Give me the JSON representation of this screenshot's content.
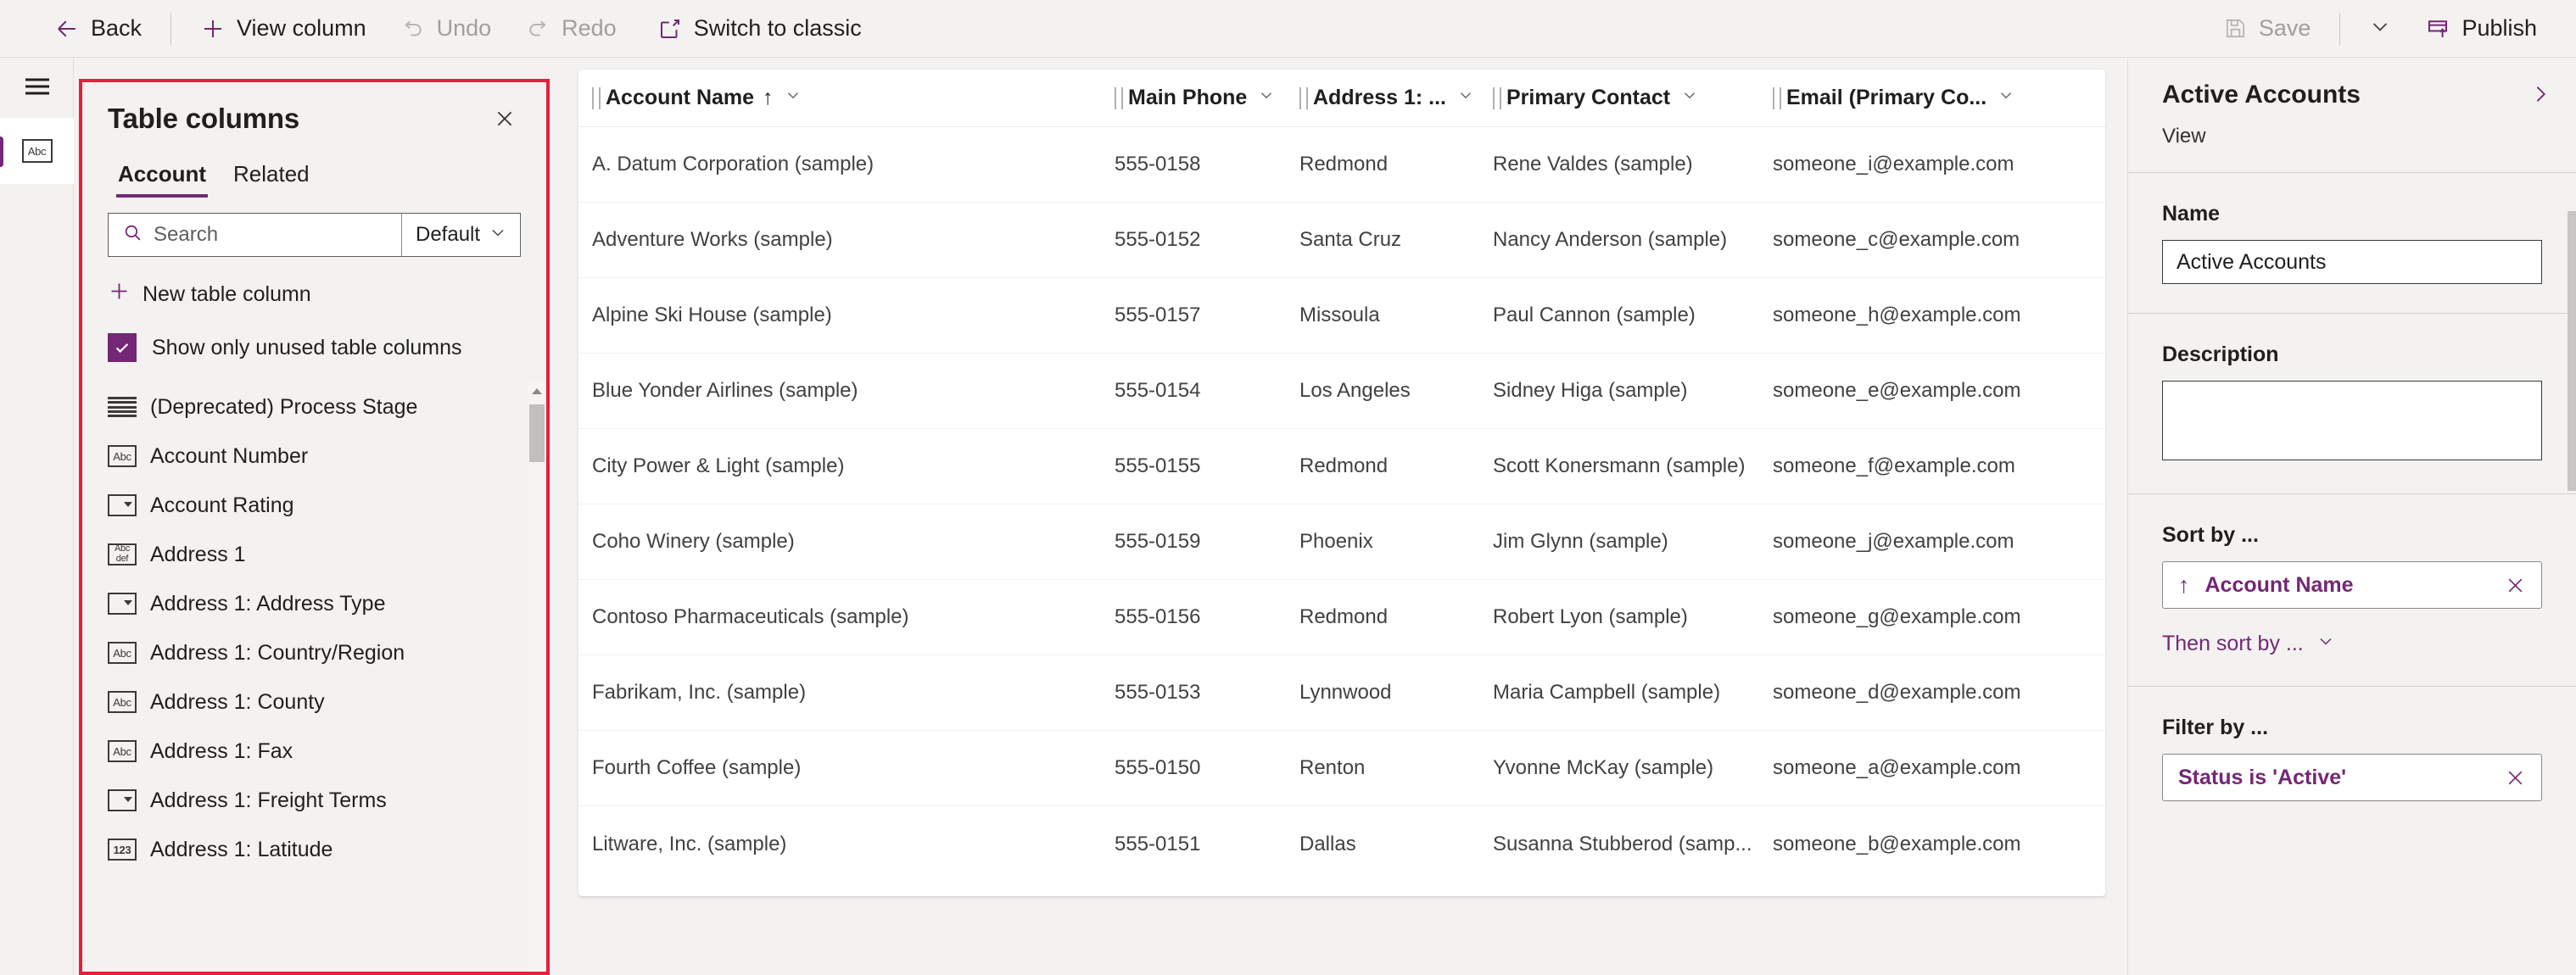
{
  "commandbar": {
    "back": "Back",
    "view_column": "View column",
    "undo": "Undo",
    "redo": "Redo",
    "switch_to_classic": "Switch to classic",
    "save": "Save",
    "publish": "Publish"
  },
  "rail": {
    "menu_icon": "hamburger-icon",
    "selected_item_icon": "abc-text-icon"
  },
  "table_columns_panel": {
    "title": "Table columns",
    "close_icon": "close-icon",
    "tabs": [
      {
        "label": "Account",
        "active": true
      },
      {
        "label": "Related",
        "active": false
      }
    ],
    "search": {
      "placeholder": "Search",
      "value": "",
      "icon": "search-icon"
    },
    "filter_dropdown": {
      "value": "Default",
      "icon": "chevron-down-icon"
    },
    "new_table_column": "New table column",
    "show_only_unused": {
      "label": "Show only unused table columns",
      "checked": true
    },
    "highlight_color": "#ec1c3b",
    "columns": [
      {
        "label": "(Deprecated) Process Stage",
        "icon": "multi-line-text-icon",
        "icon_kind": "lines"
      },
      {
        "label": "Account Number",
        "icon": "text-icon",
        "icon_kind": "abc"
      },
      {
        "label": "Account Rating",
        "icon": "choice-icon",
        "icon_kind": "dropdown"
      },
      {
        "label": "Address 1",
        "icon": "multiline-text-icon",
        "icon_kind": "abcdef"
      },
      {
        "label": "Address 1: Address Type",
        "icon": "choice-icon",
        "icon_kind": "dropdown"
      },
      {
        "label": "Address 1: Country/Region",
        "icon": "text-icon",
        "icon_kind": "abc"
      },
      {
        "label": "Address 1: County",
        "icon": "text-icon",
        "icon_kind": "abc"
      },
      {
        "label": "Address 1: Fax",
        "icon": "text-icon",
        "icon_kind": "abc"
      },
      {
        "label": "Address 1: Freight Terms",
        "icon": "choice-icon",
        "icon_kind": "dropdown"
      },
      {
        "label": "Address 1: Latitude",
        "icon": "number-icon",
        "icon_kind": "123"
      }
    ],
    "scrollbar": {
      "up_arrow_icon": "caret-up-icon"
    }
  },
  "grid": {
    "columns": [
      {
        "label": "Account Name",
        "class": "col-name",
        "sorted": true,
        "sort_arrow": "↑"
      },
      {
        "label": "Main Phone",
        "class": "col-phone",
        "sorted": false,
        "sort_arrow": ""
      },
      {
        "label": "Address 1: ...",
        "class": "col-addr",
        "sorted": false,
        "sort_arrow": ""
      },
      {
        "label": "Primary Contact",
        "class": "col-pc",
        "sorted": false,
        "sort_arrow": ""
      },
      {
        "label": "Email (Primary Co...",
        "class": "col-email",
        "sorted": false,
        "sort_arrow": ""
      }
    ],
    "rows": [
      {
        "name": "A. Datum Corporation (sample)",
        "phone": "555-0158",
        "address": "Redmond",
        "contact": "Rene Valdes (sample)",
        "email": "someone_i@example.com"
      },
      {
        "name": "Adventure Works (sample)",
        "phone": "555-0152",
        "address": "Santa Cruz",
        "contact": "Nancy Anderson (sample)",
        "email": "someone_c@example.com"
      },
      {
        "name": "Alpine Ski House (sample)",
        "phone": "555-0157",
        "address": "Missoula",
        "contact": "Paul Cannon (sample)",
        "email": "someone_h@example.com"
      },
      {
        "name": "Blue Yonder Airlines (sample)",
        "phone": "555-0154",
        "address": "Los Angeles",
        "contact": "Sidney Higa (sample)",
        "email": "someone_e@example.com"
      },
      {
        "name": "City Power & Light (sample)",
        "phone": "555-0155",
        "address": "Redmond",
        "contact": "Scott Konersmann (sample)",
        "email": "someone_f@example.com"
      },
      {
        "name": "Coho Winery (sample)",
        "phone": "555-0159",
        "address": "Phoenix",
        "contact": "Jim Glynn (sample)",
        "email": "someone_j@example.com"
      },
      {
        "name": "Contoso Pharmaceuticals (sample)",
        "phone": "555-0156",
        "address": "Redmond",
        "contact": "Robert Lyon (sample)",
        "email": "someone_g@example.com"
      },
      {
        "name": "Fabrikam, Inc. (sample)",
        "phone": "555-0153",
        "address": "Lynnwood",
        "contact": "Maria Campbell (sample)",
        "email": "someone_d@example.com"
      },
      {
        "name": "Fourth Coffee (sample)",
        "phone": "555-0150",
        "address": "Renton",
        "contact": "Yvonne McKay (sample)",
        "email": "someone_a@example.com"
      },
      {
        "name": "Litware, Inc. (sample)",
        "phone": "555-0151",
        "address": "Dallas",
        "contact": "Susanna Stubberod (samp...",
        "email": "someone_b@example.com"
      }
    ]
  },
  "properties": {
    "title": "Active Accounts",
    "subtitle": "View",
    "expand_icon": "chevron-right-icon",
    "name_label": "Name",
    "name_value": "Active Accounts",
    "description_label": "Description",
    "description_value": "",
    "sort_by_label": "Sort by ...",
    "sort_by_value": "Account Name",
    "sort_direction_icon": "↑",
    "then_sort_by_label": "Then sort by ...",
    "filter_by_label": "Filter by ...",
    "filter_value": "Status is 'Active'",
    "accent_color": "#742774"
  }
}
